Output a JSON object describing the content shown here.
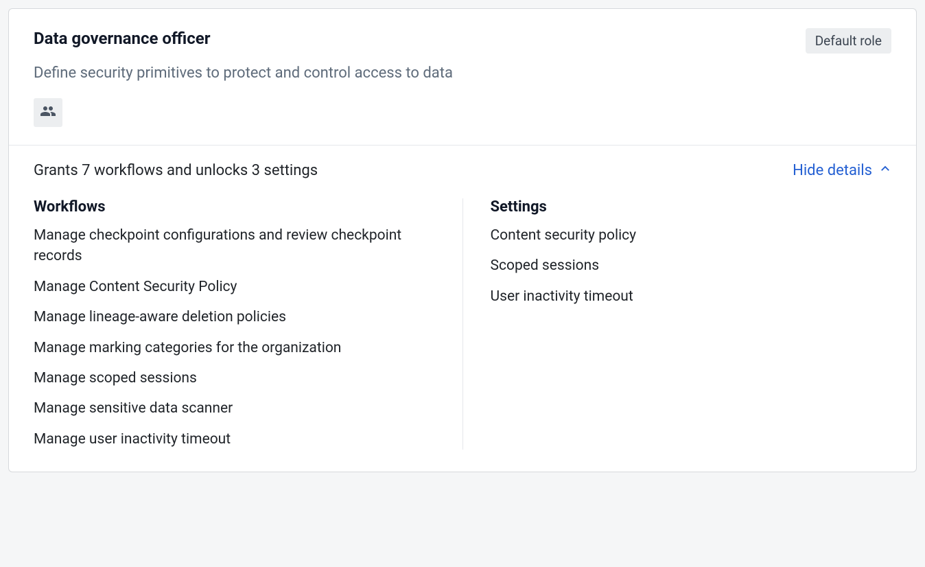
{
  "header": {
    "title": "Data governance officer",
    "badge": "Default role",
    "description": "Define security primitives to protect and control access to data"
  },
  "summary": {
    "text": "Grants 7 workflows and unlocks 3 settings",
    "toggle_label": "Hide details"
  },
  "details": {
    "workflows": {
      "heading": "Workflows",
      "items": [
        "Manage checkpoint configurations and review checkpoint records",
        "Manage Content Security Policy",
        "Manage lineage-aware deletion policies",
        "Manage marking categories for the organization",
        "Manage scoped sessions",
        "Manage sensitive data scanner",
        "Manage user inactivity timeout"
      ]
    },
    "settings": {
      "heading": "Settings",
      "items": [
        "Content security policy",
        "Scoped sessions",
        "User inactivity timeout"
      ]
    }
  }
}
